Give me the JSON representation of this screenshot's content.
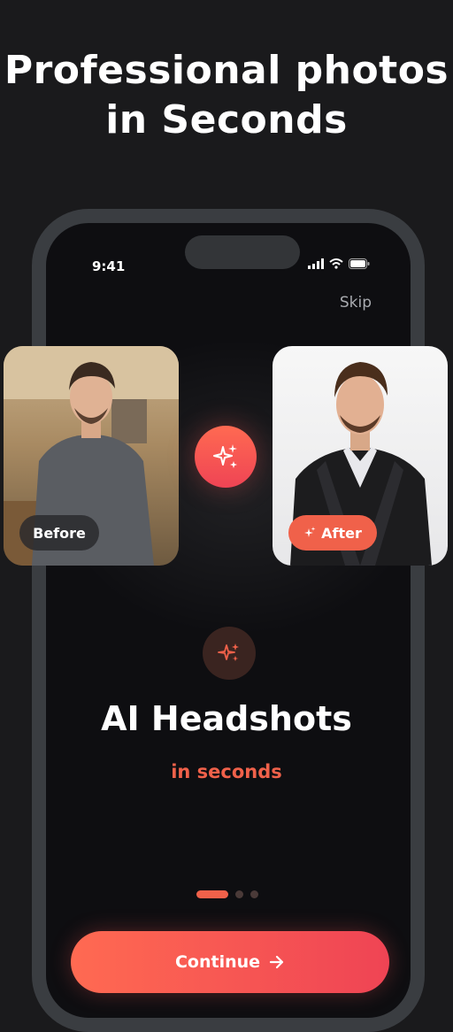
{
  "headline": {
    "line1": "Professional photos",
    "line2": "in Seconds"
  },
  "status_bar": {
    "time": "9:41",
    "icons": [
      "signal-icon",
      "wifi-icon",
      "battery-icon"
    ]
  },
  "skip_label": "Skip",
  "comparison": {
    "before_label": "Before",
    "after_label": "After",
    "center_icon": "sparkle-icon"
  },
  "feature": {
    "icon": "sparkle-icon",
    "title": "AI Headshots",
    "subtitle": "in seconds"
  },
  "pagination": {
    "total": 3,
    "active_index": 0
  },
  "continue_button": {
    "label": "Continue",
    "icon": "arrow-right-icon"
  },
  "colors": {
    "accent": "#f0614a",
    "background": "#1a1a1c",
    "phone_frame": "#3a3d41"
  }
}
